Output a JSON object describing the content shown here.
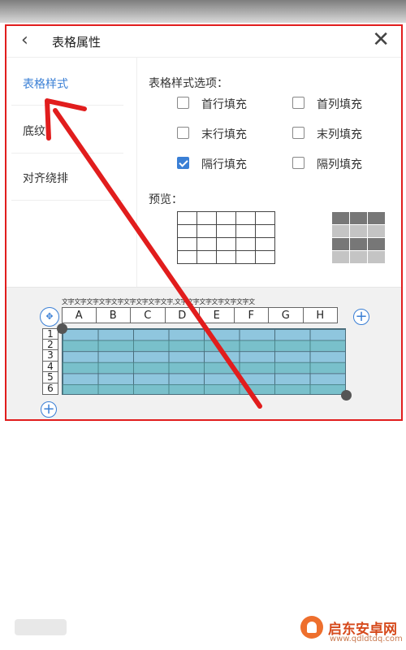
{
  "header": {
    "back_icon": "‹",
    "title": "表格属性",
    "close_icon": "✕"
  },
  "sidebar": {
    "items": [
      {
        "label": "表格样式",
        "active": true
      },
      {
        "label": "底纹",
        "active": false
      },
      {
        "label": "对齐绕排",
        "active": false
      }
    ]
  },
  "style_options": {
    "title": "表格样式选项：",
    "options": [
      {
        "label": "首行填充",
        "checked": false
      },
      {
        "label": "首列填充",
        "checked": false
      },
      {
        "label": "末行填充",
        "checked": false
      },
      {
        "label": "末列填充",
        "checked": false
      },
      {
        "label": "隔行填充",
        "checked": true
      },
      {
        "label": "隔列填充",
        "checked": false
      }
    ]
  },
  "preview": {
    "label": "预览："
  },
  "table_preview": {
    "ruler_text": "文字文字文字文字文字文字文字文字文字,文字文字文字文字文字文字文",
    "columns": [
      "A",
      "B",
      "C",
      "D",
      "E",
      "F",
      "G",
      "H"
    ],
    "rows": [
      "1",
      "2",
      "3",
      "4",
      "5",
      "6"
    ]
  },
  "colors": {
    "accent": "#3a7fd5",
    "highlight_border": "#e11d1d",
    "cell_fill": "#8fc6de",
    "arrow": "#e11d1d"
  },
  "watermark": {
    "name": "启东安卓网",
    "url": "www.qdldtdq.com"
  }
}
